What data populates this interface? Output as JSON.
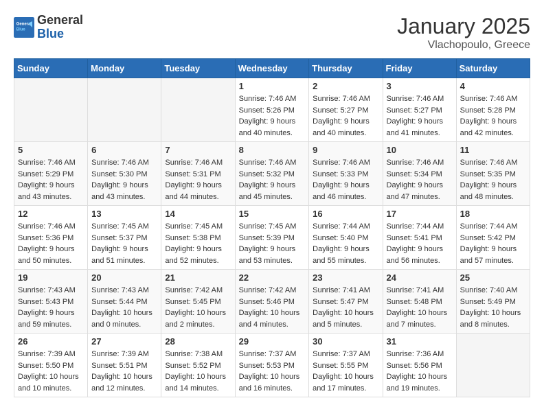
{
  "header": {
    "logo": {
      "general": "General",
      "blue": "Blue"
    },
    "title": "January 2025",
    "location": "Vlachopoulo, Greece"
  },
  "weekdays": [
    "Sunday",
    "Monday",
    "Tuesday",
    "Wednesday",
    "Thursday",
    "Friday",
    "Saturday"
  ],
  "weeks": [
    [
      {
        "day": null,
        "info": null
      },
      {
        "day": null,
        "info": null
      },
      {
        "day": null,
        "info": null
      },
      {
        "day": "1",
        "info": "Sunrise: 7:46 AM\nSunset: 5:26 PM\nDaylight: 9 hours and 40 minutes."
      },
      {
        "day": "2",
        "info": "Sunrise: 7:46 AM\nSunset: 5:27 PM\nDaylight: 9 hours and 40 minutes."
      },
      {
        "day": "3",
        "info": "Sunrise: 7:46 AM\nSunset: 5:27 PM\nDaylight: 9 hours and 41 minutes."
      },
      {
        "day": "4",
        "info": "Sunrise: 7:46 AM\nSunset: 5:28 PM\nDaylight: 9 hours and 42 minutes."
      }
    ],
    [
      {
        "day": "5",
        "info": "Sunrise: 7:46 AM\nSunset: 5:29 PM\nDaylight: 9 hours and 43 minutes."
      },
      {
        "day": "6",
        "info": "Sunrise: 7:46 AM\nSunset: 5:30 PM\nDaylight: 9 hours and 43 minutes."
      },
      {
        "day": "7",
        "info": "Sunrise: 7:46 AM\nSunset: 5:31 PM\nDaylight: 9 hours and 44 minutes."
      },
      {
        "day": "8",
        "info": "Sunrise: 7:46 AM\nSunset: 5:32 PM\nDaylight: 9 hours and 45 minutes."
      },
      {
        "day": "9",
        "info": "Sunrise: 7:46 AM\nSunset: 5:33 PM\nDaylight: 9 hours and 46 minutes."
      },
      {
        "day": "10",
        "info": "Sunrise: 7:46 AM\nSunset: 5:34 PM\nDaylight: 9 hours and 47 minutes."
      },
      {
        "day": "11",
        "info": "Sunrise: 7:46 AM\nSunset: 5:35 PM\nDaylight: 9 hours and 48 minutes."
      }
    ],
    [
      {
        "day": "12",
        "info": "Sunrise: 7:46 AM\nSunset: 5:36 PM\nDaylight: 9 hours and 50 minutes."
      },
      {
        "day": "13",
        "info": "Sunrise: 7:45 AM\nSunset: 5:37 PM\nDaylight: 9 hours and 51 minutes."
      },
      {
        "day": "14",
        "info": "Sunrise: 7:45 AM\nSunset: 5:38 PM\nDaylight: 9 hours and 52 minutes."
      },
      {
        "day": "15",
        "info": "Sunrise: 7:45 AM\nSunset: 5:39 PM\nDaylight: 9 hours and 53 minutes."
      },
      {
        "day": "16",
        "info": "Sunrise: 7:44 AM\nSunset: 5:40 PM\nDaylight: 9 hours and 55 minutes."
      },
      {
        "day": "17",
        "info": "Sunrise: 7:44 AM\nSunset: 5:41 PM\nDaylight: 9 hours and 56 minutes."
      },
      {
        "day": "18",
        "info": "Sunrise: 7:44 AM\nSunset: 5:42 PM\nDaylight: 9 hours and 57 minutes."
      }
    ],
    [
      {
        "day": "19",
        "info": "Sunrise: 7:43 AM\nSunset: 5:43 PM\nDaylight: 9 hours and 59 minutes."
      },
      {
        "day": "20",
        "info": "Sunrise: 7:43 AM\nSunset: 5:44 PM\nDaylight: 10 hours and 0 minutes."
      },
      {
        "day": "21",
        "info": "Sunrise: 7:42 AM\nSunset: 5:45 PM\nDaylight: 10 hours and 2 minutes."
      },
      {
        "day": "22",
        "info": "Sunrise: 7:42 AM\nSunset: 5:46 PM\nDaylight: 10 hours and 4 minutes."
      },
      {
        "day": "23",
        "info": "Sunrise: 7:41 AM\nSunset: 5:47 PM\nDaylight: 10 hours and 5 minutes."
      },
      {
        "day": "24",
        "info": "Sunrise: 7:41 AM\nSunset: 5:48 PM\nDaylight: 10 hours and 7 minutes."
      },
      {
        "day": "25",
        "info": "Sunrise: 7:40 AM\nSunset: 5:49 PM\nDaylight: 10 hours and 8 minutes."
      }
    ],
    [
      {
        "day": "26",
        "info": "Sunrise: 7:39 AM\nSunset: 5:50 PM\nDaylight: 10 hours and 10 minutes."
      },
      {
        "day": "27",
        "info": "Sunrise: 7:39 AM\nSunset: 5:51 PM\nDaylight: 10 hours and 12 minutes."
      },
      {
        "day": "28",
        "info": "Sunrise: 7:38 AM\nSunset: 5:52 PM\nDaylight: 10 hours and 14 minutes."
      },
      {
        "day": "29",
        "info": "Sunrise: 7:37 AM\nSunset: 5:53 PM\nDaylight: 10 hours and 16 minutes."
      },
      {
        "day": "30",
        "info": "Sunrise: 7:37 AM\nSunset: 5:55 PM\nDaylight: 10 hours and 17 minutes."
      },
      {
        "day": "31",
        "info": "Sunrise: 7:36 AM\nSunset: 5:56 PM\nDaylight: 10 hours and 19 minutes."
      },
      {
        "day": null,
        "info": null
      }
    ]
  ]
}
